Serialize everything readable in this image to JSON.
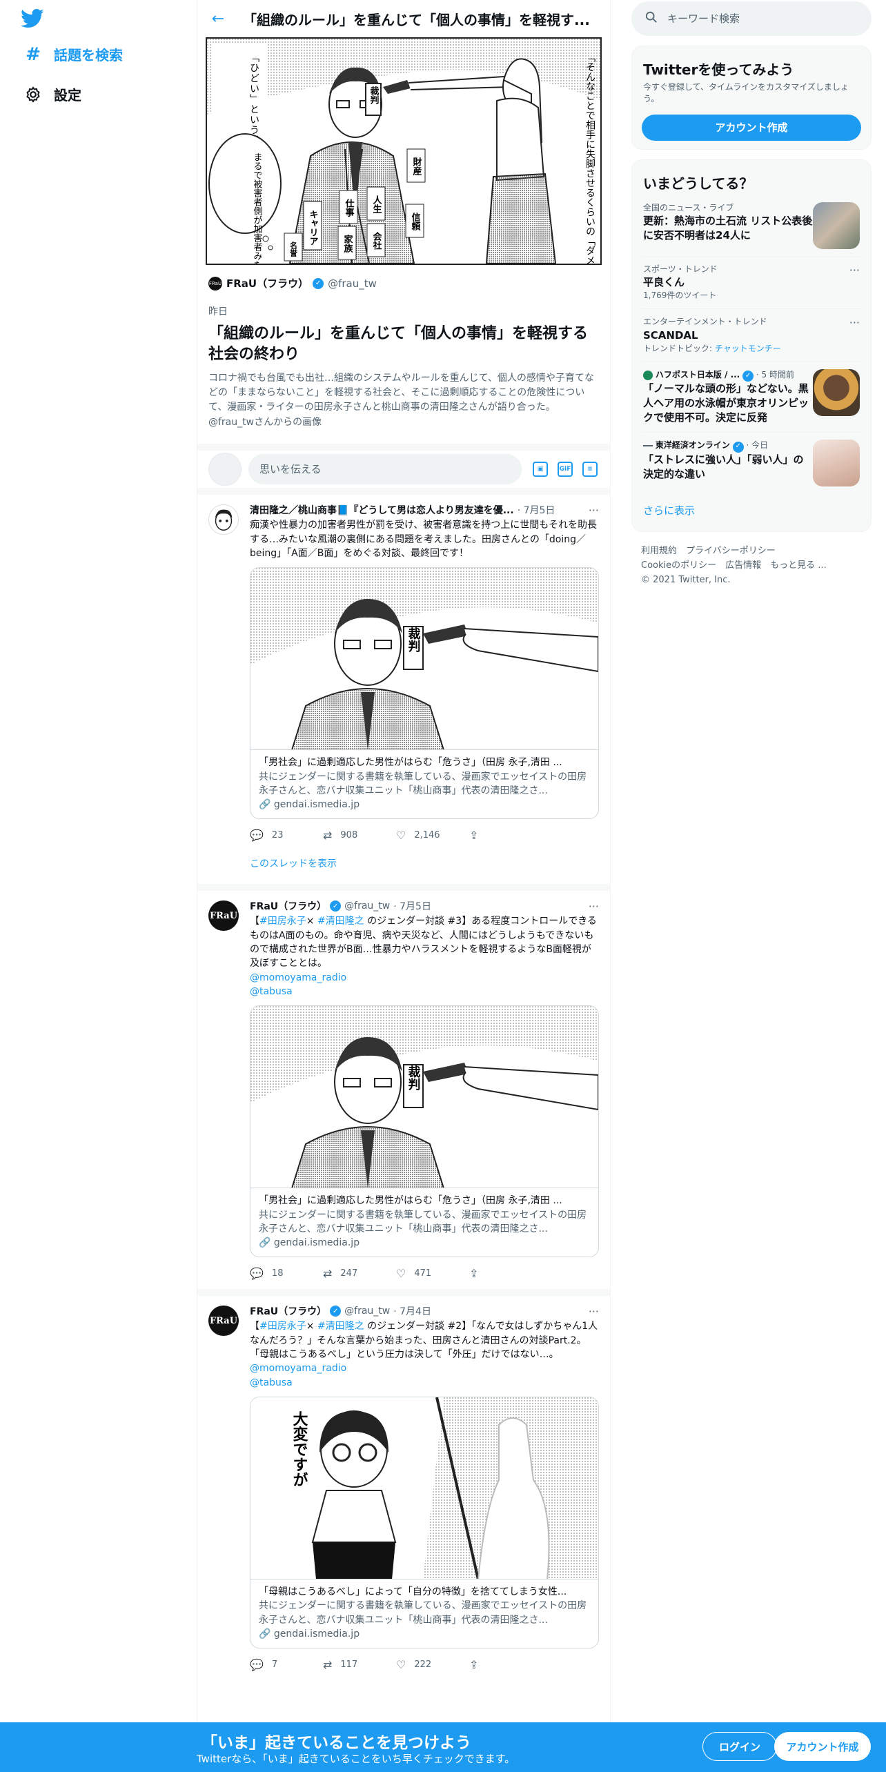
{
  "nav": {
    "logo_icon": "twitter-bird-icon",
    "explore_label": "話題を検索",
    "settings_label": "設定"
  },
  "header": {
    "back_icon": "arrow-left-icon",
    "title": "「組織のルール」を重んじて「個人の事情」を軽視す..."
  },
  "focus_card": {
    "author_name": "FRaU（フラウ）",
    "author_handle": "@frau_tw",
    "date": "昨日",
    "title": "「組織のルール」を重んじて「個人の事情」を軽視する社会の終わり",
    "description": "コロナ禍でも台風でも出社…組織のシステムやルールを重んじて、個人の感情や子育てなどの「ままならないこと」を軽視する社会と、そこに過剰順応することの危険性について、漫画家・ライターの田房永子さんと桃山商事の清田隆之さんが語り合った。",
    "source": "@frau_twさんからの画像",
    "image_texts": {
      "speech_left": "「ひどい」という感覚があるんだろう",
      "speech_right": "「そんなことで相手に失脚させるくらいの「ダメージ」を負わせるなんて",
      "bubble": "まるで被害者側が加害者みたいな",
      "sign": "裁判",
      "tag1": "財産",
      "tag2": "人生",
      "tag3": "仕事",
      "tag4": "家族",
      "tag5": "会社",
      "tag6": "キャリア",
      "tag7": "信頼",
      "tag8": "名誉"
    }
  },
  "compose": {
    "placeholder": "思いを伝える",
    "icons": [
      "image-icon",
      "gif-icon",
      "poll-icon"
    ]
  },
  "tweets": [
    {
      "author": "清田隆之／桃山商事📘『どうして男は恋人より男友達を優...",
      "handle": "",
      "date": "· 7月5日",
      "text": "痴漢や性暴力の加害者男性が罰を受け、被害者意識を持つ上に世間もそれを助長する…みたいな風潮の裏側にある問題を考えました。田房さんとの「doing／being」「A面／B面」をめぐる対談、最終回です！",
      "mentions": [],
      "card_title": "「男社会」に過剰適応した男性がはらむ「危うさ」（田房 永子,清田 ...",
      "card_desc": "共にジェンダーに関する書籍を執筆している、漫画家でエッセイストの田房永子さんと、恋バナ収集ユニット「桃山商事」代表の清田隆之さ...",
      "card_domain": "gendai.ismedia.jp",
      "image_sign": "裁判",
      "replies": "23",
      "retweets": "908",
      "likes": "2,146",
      "show_thread": "このスレッドを表示"
    },
    {
      "author": "FRaU（フラウ）",
      "handle": "@frau_tw",
      "date": "· 7月5日",
      "text_prefix": "【",
      "hashtag1": "#田房永子",
      "text_mid": "× ",
      "hashtag2": "#清田隆之",
      "text": " のジェンダー対談 #3】ある程度コントロールできるものはA面のもの。命や育児、病や天災など、人間にはどうしようもできないもので構成された世界がB面…性暴力やハラスメントを軽視するようなB面軽視が及ぼすこととは。",
      "mentions": [
        "@momoyama_radio",
        "@tabusa"
      ],
      "card_title": "「男社会」に過剰適応した男性がはらむ「危うさ」（田房 永子,清田 ...",
      "card_desc": "共にジェンダーに関する書籍を執筆している、漫画家でエッセイストの田房永子さんと、恋バナ収集ユニット「桃山商事」代表の清田隆之さ...",
      "card_domain": "gendai.ismedia.jp",
      "image_sign": "裁判",
      "replies": "18",
      "retweets": "247",
      "likes": "471"
    },
    {
      "author": "FRaU（フラウ）",
      "handle": "@frau_tw",
      "date": "· 7月4日",
      "text_prefix": "【",
      "hashtag1": "#田房永子",
      "text_mid": "× ",
      "hashtag2": "#清田隆之",
      "text": " のジェンダー対談 #2】「なんで女はしずかちゃん1人なんだろう？」そんな言葉から始まった、田房さんと清田さんの対談Part.2。「母親はこうあるべし」という圧力は決して「外圧」だけではない…。",
      "mentions": [
        "@momoyama_radio",
        "@tabusa"
      ],
      "card_title": "「母親はこうあるべし」によって「自分の特徴」を捨ててしまう女性...",
      "card_desc": "共にジェンダーに関する書籍を執筆している、漫画家でエッセイストの田房永子さんと、恋バナ収集ユニット「桃山商事」代表の清田隆之さ...",
      "card_domain": "gendai.ismedia.jp",
      "image_text": "大変ですが",
      "replies": "7",
      "retweets": "117",
      "likes": "222"
    }
  ],
  "avatar_text": "FRaU",
  "right": {
    "search_placeholder": "キーワード検索",
    "signup_panel": {
      "title": "Twitterを使ってみよう",
      "subtitle": "今すぐ登録して、タイムラインをカスタマイズしましょう。",
      "button": "アカウント作成"
    },
    "trends": {
      "title": "いまどうしてる？",
      "items": [
        {
          "meta": "全国のニュース・ライブ",
          "main": "更新：熱海市の土石流 リスト公表後に安否不明者は24人に",
          "extra": ""
        },
        {
          "meta": "スポーツ・トレンド",
          "main": "平良くん",
          "extra": "1,769件のツイート"
        },
        {
          "meta": "エンターテインメント・トレンド",
          "main": "SCANDAL",
          "extra_prefix": "トレンドトピック: ",
          "extra_link": "チャットモンチー"
        },
        {
          "meta": "ハフポスト日本版 / ...",
          "meta_time": "· 5 時間前",
          "main": "「ノーマルな頭の形」などない。黒人ヘア用の水泳帽が東京オリンピックで使用不可。決定に反発"
        },
        {
          "meta": "東洋経済オンライン",
          "meta_time": "· 今日",
          "main": "「ストレスに強い人」「弱い人」の決定的な違い"
        }
      ],
      "show_more": "さらに表示"
    },
    "footer": {
      "terms": "利用規約",
      "privacy": "プライバシーポリシー",
      "cookie": "Cookieのポリシー",
      "ads": "広告情報",
      "more": "もっと見る ...",
      "copyright": "© 2021 Twitter, Inc."
    }
  },
  "bottom_bar": {
    "title": "「いま」起きていることを見つけよう",
    "subtitle": "Twitterなら、「いま」起きていることをいち早くチェックできます。",
    "login": "ログイン",
    "signup": "アカウント作成"
  },
  "colors": {
    "accent": "#1d9bf0",
    "text": "#0f1419",
    "secondary": "#536471"
  }
}
